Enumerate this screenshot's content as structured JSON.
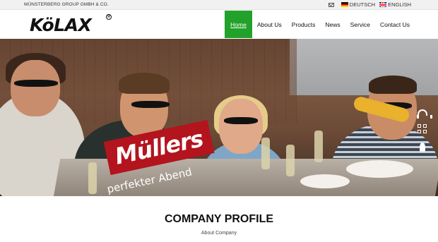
{
  "topbar": {
    "company": "MÜNSTERBERG GROUP GMBH & CO.",
    "languages": [
      {
        "label": "DEUTSCH",
        "flag": "de-flag-icon"
      },
      {
        "label": "ENGLISH",
        "flag": "uk-flag-icon"
      }
    ],
    "mail_icon": "mail-icon"
  },
  "header": {
    "logo": "KöLAX",
    "logo_mark": "R",
    "nav": [
      {
        "label": "Home",
        "active": true
      },
      {
        "label": "About Us"
      },
      {
        "label": "Products"
      },
      {
        "label": "News"
      },
      {
        "label": "Service"
      },
      {
        "label": "Contact Us"
      }
    ],
    "accent": "#22a22a"
  },
  "hero": {
    "brand": "Müllers",
    "tagline": "perfekter Abend",
    "banner_color": "#b3141e",
    "side_tools": [
      "headset-icon",
      "qr-code-icon",
      "rocket-icon"
    ]
  },
  "section": {
    "title": "COMPANY PROFILE",
    "subtitle": "About Company"
  }
}
